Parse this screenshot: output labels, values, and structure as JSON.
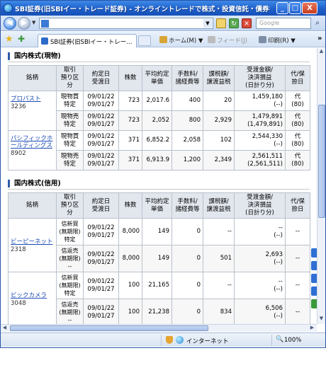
{
  "window": {
    "title": "SBI証券(旧SBIイー・トレード証券) - オンライントレードで株式・投資信託・債券を - - Wi...",
    "min_label": "_",
    "max_label": "□",
    "close_label": "X"
  },
  "address": {
    "url": "",
    "search_placeholder": "Google",
    "search_icon": "search-icon"
  },
  "tabs": [
    {
      "label": "SBI証券(旧SBIイー・トレー..."
    }
  ],
  "commands": {
    "home": "ホーム(M)",
    "feed": "フィード(J)",
    "print": "印刷(R)"
  },
  "cash_section": {
    "title": "国内株式(現物)",
    "headers": [
      "銘柄",
      "取引\n預り区分",
      "約定日\n受渡日",
      "株数",
      "平均約定\n単価",
      "手数料/\n諸経費等",
      "課税額/\n譲渡益税",
      "受渡金額/\n決済損益\n(日計り分)",
      "代/保\n捺日"
    ],
    "stocks": [
      {
        "name": "プロパスト",
        "code": "3236",
        "rows": [
          {
            "type": "現物買",
            "account": "特定",
            "trade_date": "09/01/22",
            "settle_date": "09/01/27",
            "qty": "723",
            "price": "2,017.6",
            "fee": "400",
            "tax": "20",
            "amount": "1,459,180",
            "pl": "(--)",
            "sub": "代",
            "sub2": "(80)"
          },
          {
            "type": "現物売",
            "account": "特定",
            "trade_date": "09/01/22",
            "settle_date": "09/01/27",
            "qty": "723",
            "price": "2,052",
            "fee": "800",
            "tax": "2,929",
            "amount": "1,479,891",
            "pl": "(1,479,891)",
            "sub": "代",
            "sub2": "(80)"
          }
        ]
      },
      {
        "name": "パシフィックホールディングス",
        "code": "8902",
        "rows": [
          {
            "type": "現物買",
            "account": "特定",
            "trade_date": "09/01/22",
            "settle_date": "09/01/27",
            "qty": "371",
            "price": "6,852.2",
            "fee": "2,058",
            "tax": "102",
            "amount": "2,544,330",
            "pl": "(--)",
            "sub": "代",
            "sub2": "(80)"
          },
          {
            "type": "現物売",
            "account": "特定",
            "trade_date": "09/01/22",
            "settle_date": "09/01/27",
            "qty": "371",
            "price": "6,913.9",
            "fee": "1,200",
            "tax": "2,349",
            "amount": "2,561,511",
            "pl": "(2,561,511)",
            "sub": "代",
            "sub2": "(80)"
          }
        ]
      }
    ]
  },
  "margin_section": {
    "title": "国内株式(信用)",
    "headers": [
      "銘柄",
      "取引\n預り区分",
      "約定日\n受渡日",
      "株数",
      "平均約定\n単価",
      "手数料/\n諸経費等",
      "課税額/\n譲渡益税",
      "受渡金額/\n決済損益\n(日計り分)",
      "代/保\n捺日"
    ],
    "stocks": [
      {
        "name": "ビーピーネット",
        "code": "2318",
        "rows": [
          {
            "type": "信新買",
            "term": "(無期限)",
            "account": "特定",
            "trade_date": "09/01/22",
            "settle_date": "09/01/27",
            "qty": "8,000",
            "price": "149",
            "fee": "0",
            "tax": "--",
            "amount": "--",
            "pl": "(--)",
            "sub": "--"
          },
          {
            "type": "信返売",
            "term": "(無期限)",
            "account": "--",
            "trade_date": "09/01/22",
            "settle_date": "09/01/27",
            "qty": "8,000",
            "price": "149",
            "fee": "0",
            "tax": "501",
            "amount": "2,693",
            "pl": "(--)",
            "sub": "--"
          }
        ]
      },
      {
        "name": "ビックカメラ",
        "code": "3048",
        "rows": [
          {
            "type": "信新買",
            "term": "(無期限)",
            "account": "特定",
            "trade_date": "09/01/22",
            "settle_date": "09/01/27",
            "qty": "100",
            "price": "21,165",
            "fee": "0",
            "tax": "--",
            "amount": "--",
            "pl": "(--)",
            "sub": "--"
          },
          {
            "type": "信返売",
            "term": "(無期限)",
            "account": "--",
            "trade_date": "09/01/22",
            "settle_date": "09/01/27",
            "qty": "100",
            "price": "21,238",
            "fee": "0",
            "tax": "834",
            "amount": "6,506",
            "pl": "(--)",
            "sub": "--"
          }
        ]
      }
    ]
  },
  "status": {
    "zone": "インターネット",
    "zoom": "100%"
  }
}
